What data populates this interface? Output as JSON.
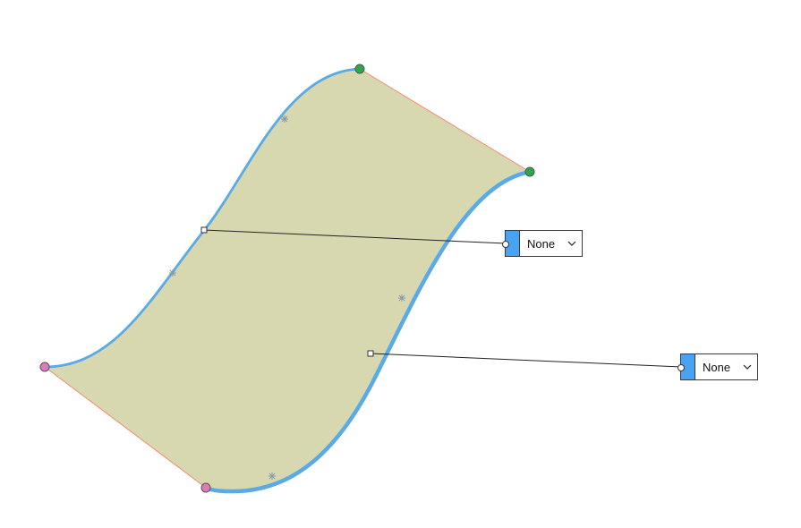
{
  "colors": {
    "surface_fill": "#d8d8b0",
    "edge_curve": "#5aaae6",
    "straight_edge": "#f08a70",
    "start_point": "#e07ab8",
    "end_point": "#2aa84a",
    "dropdown_accent": "#4aa3f0"
  },
  "icons": {
    "chevron": "chevron-down-icon"
  },
  "dropdowns": [
    {
      "value": "None"
    },
    {
      "value": "None"
    }
  ]
}
